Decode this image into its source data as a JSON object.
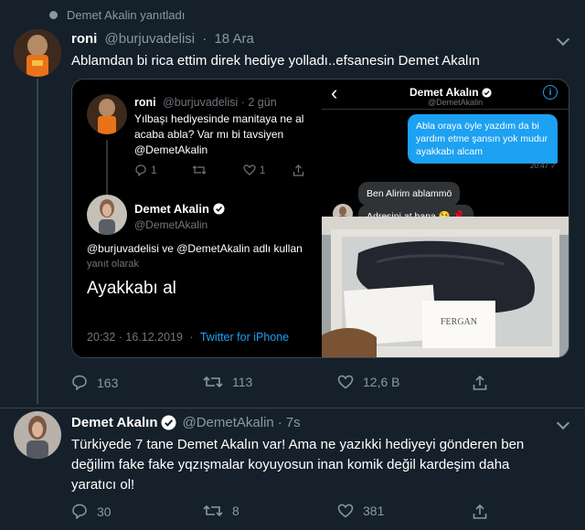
{
  "context": {
    "text": "Demet Akalin yanıtladı"
  },
  "tweet1": {
    "name": "roni",
    "handle": "@burjuvadelisi",
    "sep": "·",
    "date": "18 Ara",
    "text": "Ablamdan bi rica ettim direk hediye yolladı..efsanesin Demet Akalın",
    "actions": {
      "replies": "163",
      "retweets": "113",
      "likes": "12,6 B"
    }
  },
  "embed_left": {
    "name": "roni",
    "handle_time": "@burjuvadelisi · 2 gün",
    "line1": "Yılbaşı hediyesinde manitaya ne al",
    "line2": "acaba abla? Var mı bi tavsiyen",
    "mention": "@DemetAkalin",
    "counts": {
      "replies": "1",
      "likes": "1"
    },
    "reply_name": "Demet Akalin",
    "reply_handle": "@DemetAkalin",
    "reply_to": "@burjuvadelisi ve @DemetAkalin adlı kullan",
    "reply_label": "yanıt olarak",
    "reply_text": "Ayakkabı al",
    "timestamp": "20:32 · 16.12.2019",
    "source": "Twitter for iPhone"
  },
  "embed_right": {
    "back": "‹",
    "name": "Demet Akalın",
    "handle": "@DemetAkalin",
    "info": "i",
    "bubble_out": "Abla oraya öyle yazdım da bi yardım etme şansın yok mudur ayakkabı alcam",
    "bubble_time": "20:47 ✓",
    "bubble_in1": "Ben Alirim ablammö",
    "bubble_in2": "Adresini at bana 😘 🌹",
    "card_brand": "FERGAN"
  },
  "tweet2": {
    "name": "Demet Akalın",
    "handle": "@DemetAkalin",
    "sep": "·",
    "date": "7s",
    "line1": "Türkiyede 7 tane Demet Akalın var! Ama ne yazıkki hediyeyi gönderen ben",
    "line2": "değilim fake fake yqzışmalar koyuyosun inan komik değil kardeşim daha",
    "line3": "yaratıcı ol!",
    "actions": {
      "replies": "30",
      "retweets": "8",
      "likes": "381"
    }
  },
  "colors": {
    "background": "#15202b",
    "muted": "#8899a6",
    "accent": "#1da1f2"
  }
}
